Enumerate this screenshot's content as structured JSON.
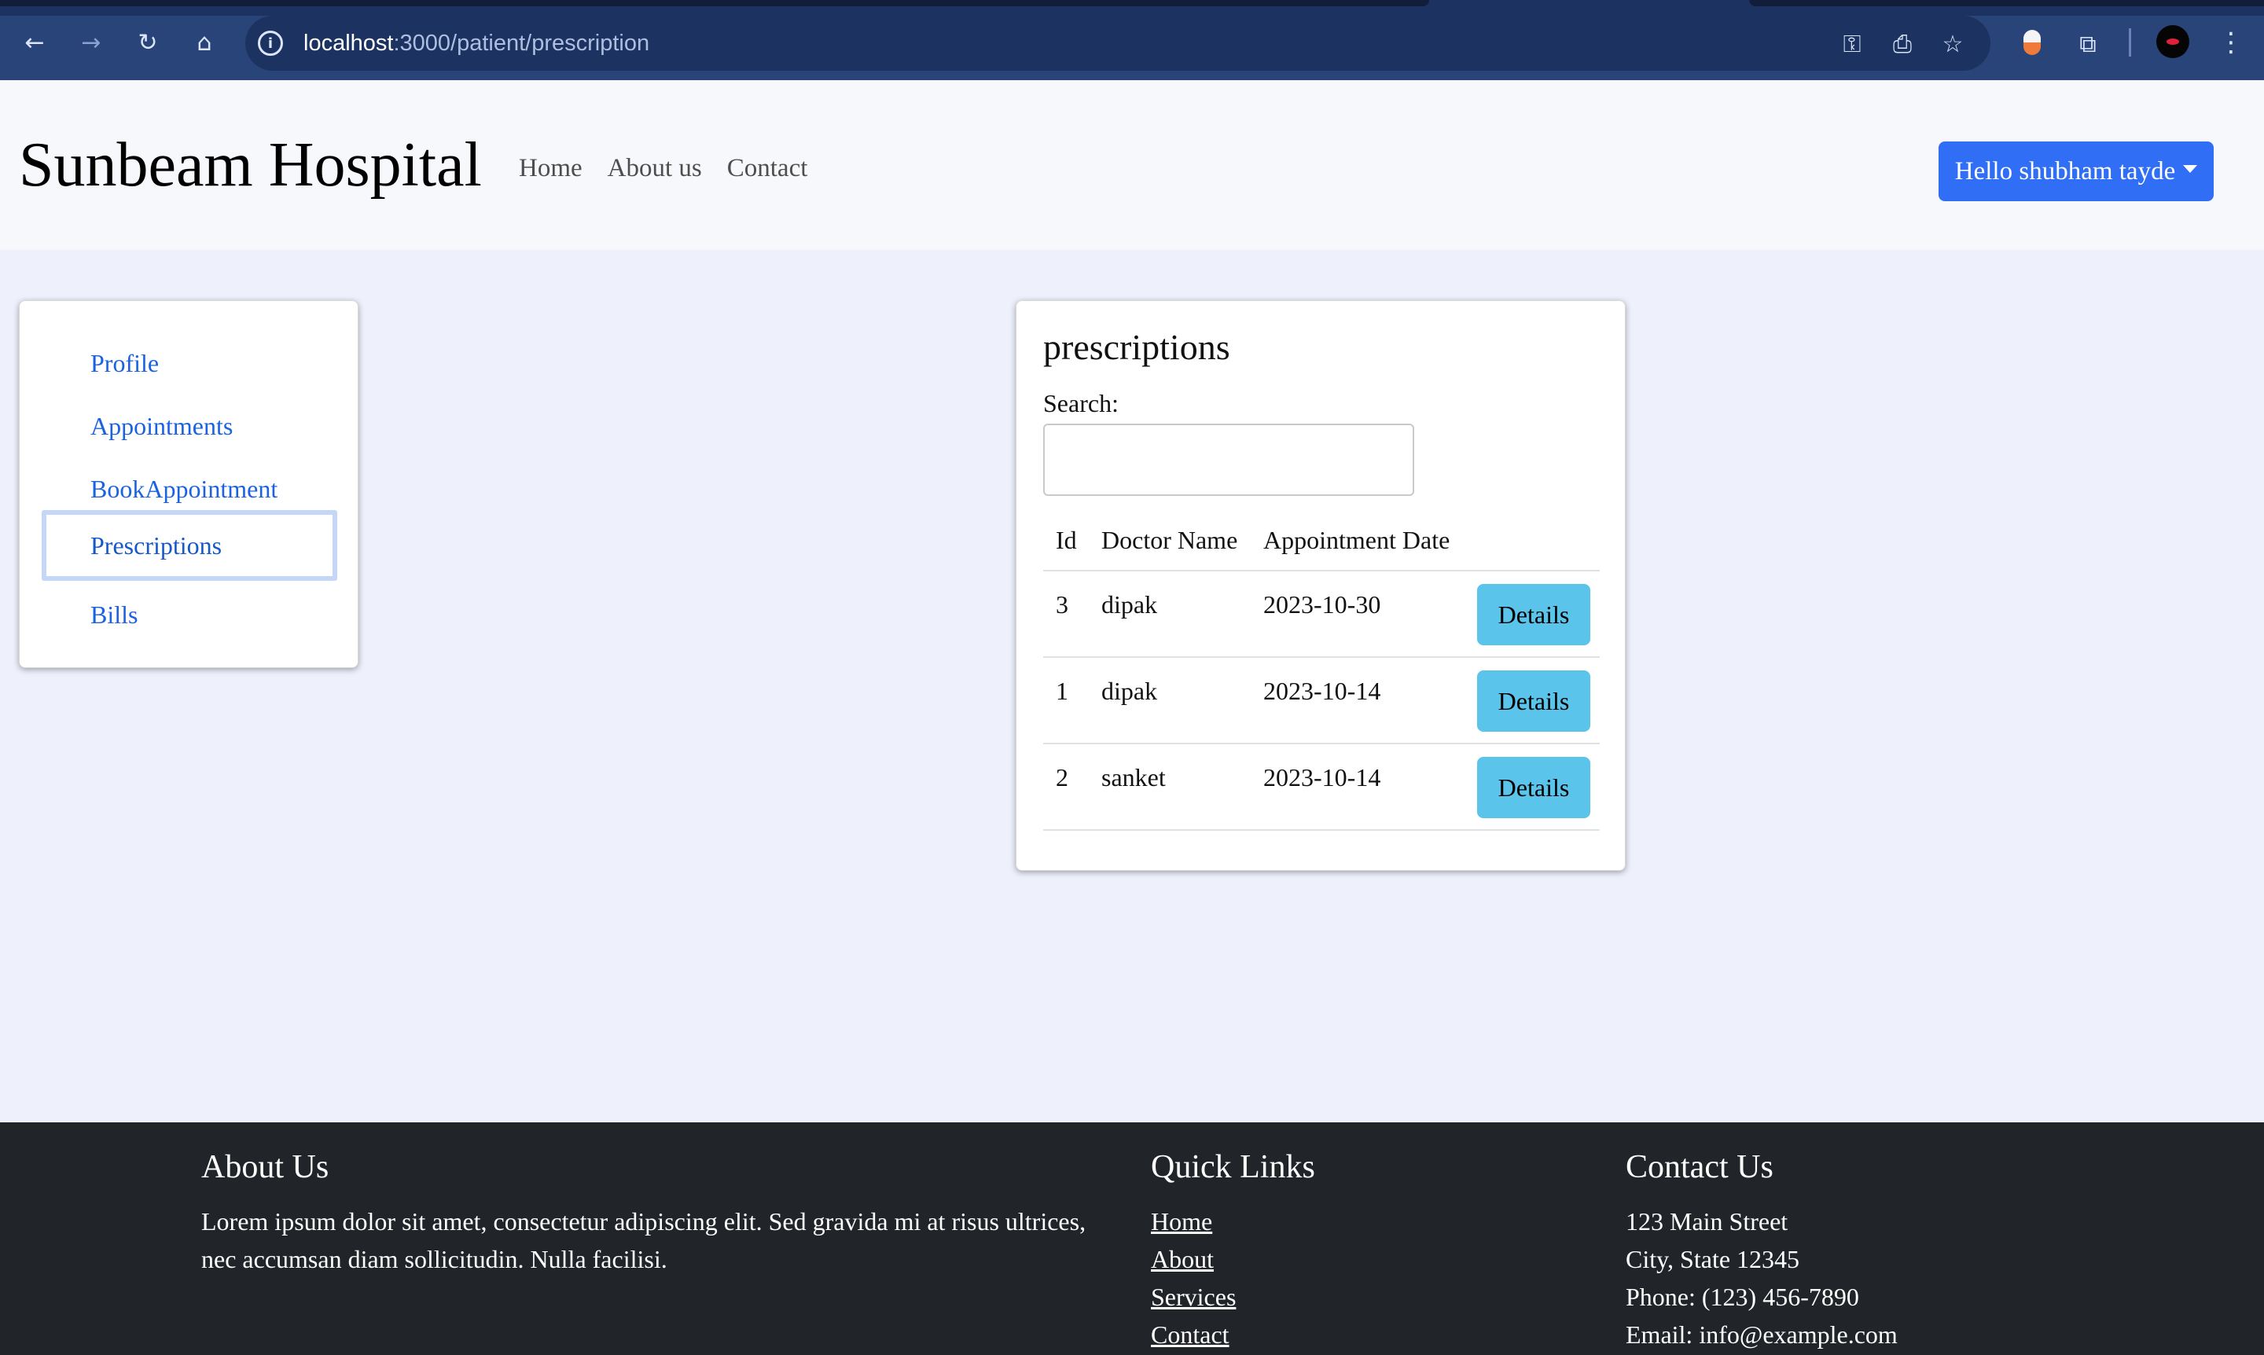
{
  "browser": {
    "url_host": "localhost",
    "url_path": ":3000/patient/prescription",
    "icons": [
      "back-arrow-icon",
      "forward-arrow-icon",
      "reload-icon",
      "home-icon",
      "info-icon",
      "key-icon",
      "install-icon",
      "star-icon",
      "extension-icon",
      "puzzle-icon",
      "profile-avatar-icon",
      "kebab-menu-icon"
    ]
  },
  "navbar": {
    "brand": "Sunbeam Hospital",
    "links": [
      "Home",
      "About us",
      "Contact"
    ],
    "user_button": "Hello shubham tayde"
  },
  "sidebar": {
    "items": [
      {
        "label": "Profile",
        "active": false
      },
      {
        "label": "Appointments",
        "active": false
      },
      {
        "label": "BookAppointment",
        "active": false
      },
      {
        "label": "Prescriptions",
        "active": true
      },
      {
        "label": "Bills",
        "active": false
      }
    ]
  },
  "prescriptions": {
    "title": "prescriptions",
    "search_label": "Search:",
    "search_value": "",
    "columns": [
      "Id",
      "Doctor Name",
      "Appointment Date"
    ],
    "rows": [
      {
        "id": "3",
        "doctor": "dipak",
        "date": "2023-10-30",
        "action": "Details"
      },
      {
        "id": "1",
        "doctor": "dipak",
        "date": "2023-10-14",
        "action": "Details"
      },
      {
        "id": "2",
        "doctor": "sanket",
        "date": "2023-10-14",
        "action": "Details"
      }
    ]
  },
  "footer": {
    "about": {
      "title": "About Us",
      "text_line1": "Lorem ipsum dolor sit amet, consectetur adipiscing elit. Sed gravida mi at risus ultrices,",
      "text_line2": "nec accumsan diam sollicitudin. Nulla facilisi."
    },
    "quick_links": {
      "title": "Quick Links",
      "links": [
        "Home",
        "About",
        "Services",
        "Contact"
      ]
    },
    "contact": {
      "title": "Contact Us",
      "lines": [
        "123 Main Street",
        "City, State 12345",
        "Phone: (123) 456-7890",
        "Email: info@example.com"
      ]
    }
  },
  "colors": {
    "chrome": "#284478",
    "primary": "#2f6ef5",
    "info": "#5bc4ea",
    "footer": "#212529",
    "page_bg": "#eef1fc",
    "link": "#1a62e0"
  }
}
